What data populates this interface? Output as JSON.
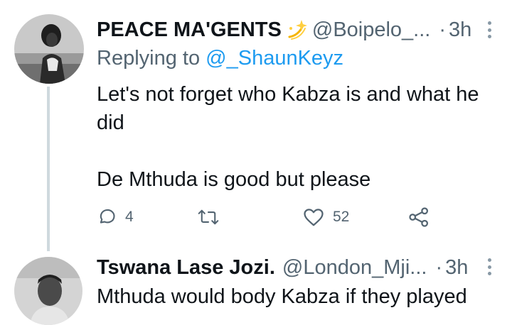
{
  "tweets": [
    {
      "display_name": "PEACE MA'GENTS",
      "emoji": "sparkle-emoji",
      "handle": "@Boipelo_...",
      "separator": "·",
      "time": "3h",
      "replying_label": "Replying to",
      "replying_to": "@_ShaunKeyz",
      "text_line1": "Let's not forget who Kabza is and what he did",
      "text_line2": "De Mthuda is good but please",
      "reply_count": "4",
      "retweet_count": "",
      "like_count": "52"
    },
    {
      "display_name": "Tswana Lase Jozi.",
      "handle": "@London_Mji...",
      "separator": "·",
      "time": "3h",
      "text_line1": "Mthuda would body Kabza if they played"
    }
  ],
  "colors": {
    "text": "#0f1419",
    "secondary": "#536471",
    "link": "#1d9bf0",
    "thread_line": "#cfd9de"
  },
  "icons": [
    "reply-icon",
    "retweet-icon",
    "like-icon",
    "share-icon",
    "more-icon"
  ]
}
